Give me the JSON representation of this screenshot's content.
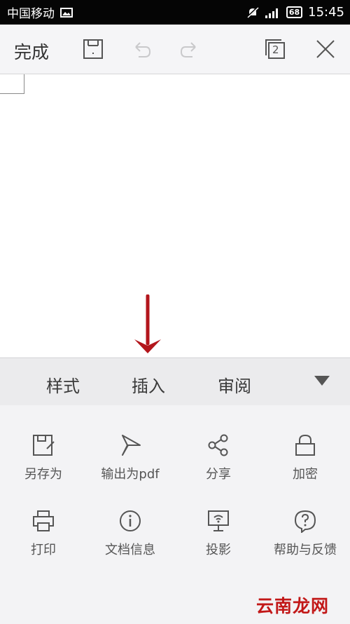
{
  "status_bar": {
    "carrier": "中国移动",
    "battery": "68",
    "time": "15:45",
    "icons": [
      "image-icon",
      "muted-icon",
      "signal-icon",
      "battery-icon"
    ]
  },
  "toolbar": {
    "done_label": "完成",
    "tab_count": "2",
    "icons": [
      "save-icon",
      "undo-icon",
      "redo-icon",
      "multi-doc-icon",
      "close-icon"
    ]
  },
  "tabs": {
    "items": [
      {
        "label": "样式"
      },
      {
        "label": "插入"
      },
      {
        "label": "审阅"
      }
    ],
    "expand_icon": "caret-down-icon"
  },
  "menu": {
    "items": [
      {
        "label": "另存为",
        "icon": "save-as-icon"
      },
      {
        "label": "输出为pdf",
        "icon": "export-pdf-icon"
      },
      {
        "label": "分享",
        "icon": "share-icon"
      },
      {
        "label": "加密",
        "icon": "lock-icon"
      },
      {
        "label": "打印",
        "icon": "print-icon"
      },
      {
        "label": "文档信息",
        "icon": "info-icon"
      },
      {
        "label": "投影",
        "icon": "projection-icon"
      },
      {
        "label": "帮助与反馈",
        "icon": "help-icon"
      }
    ]
  },
  "annotation": {
    "arrow_color": "#b3161c",
    "icon": "down-arrow-icon"
  },
  "watermark": {
    "text": "云南龙网",
    "color": "#c21818"
  }
}
